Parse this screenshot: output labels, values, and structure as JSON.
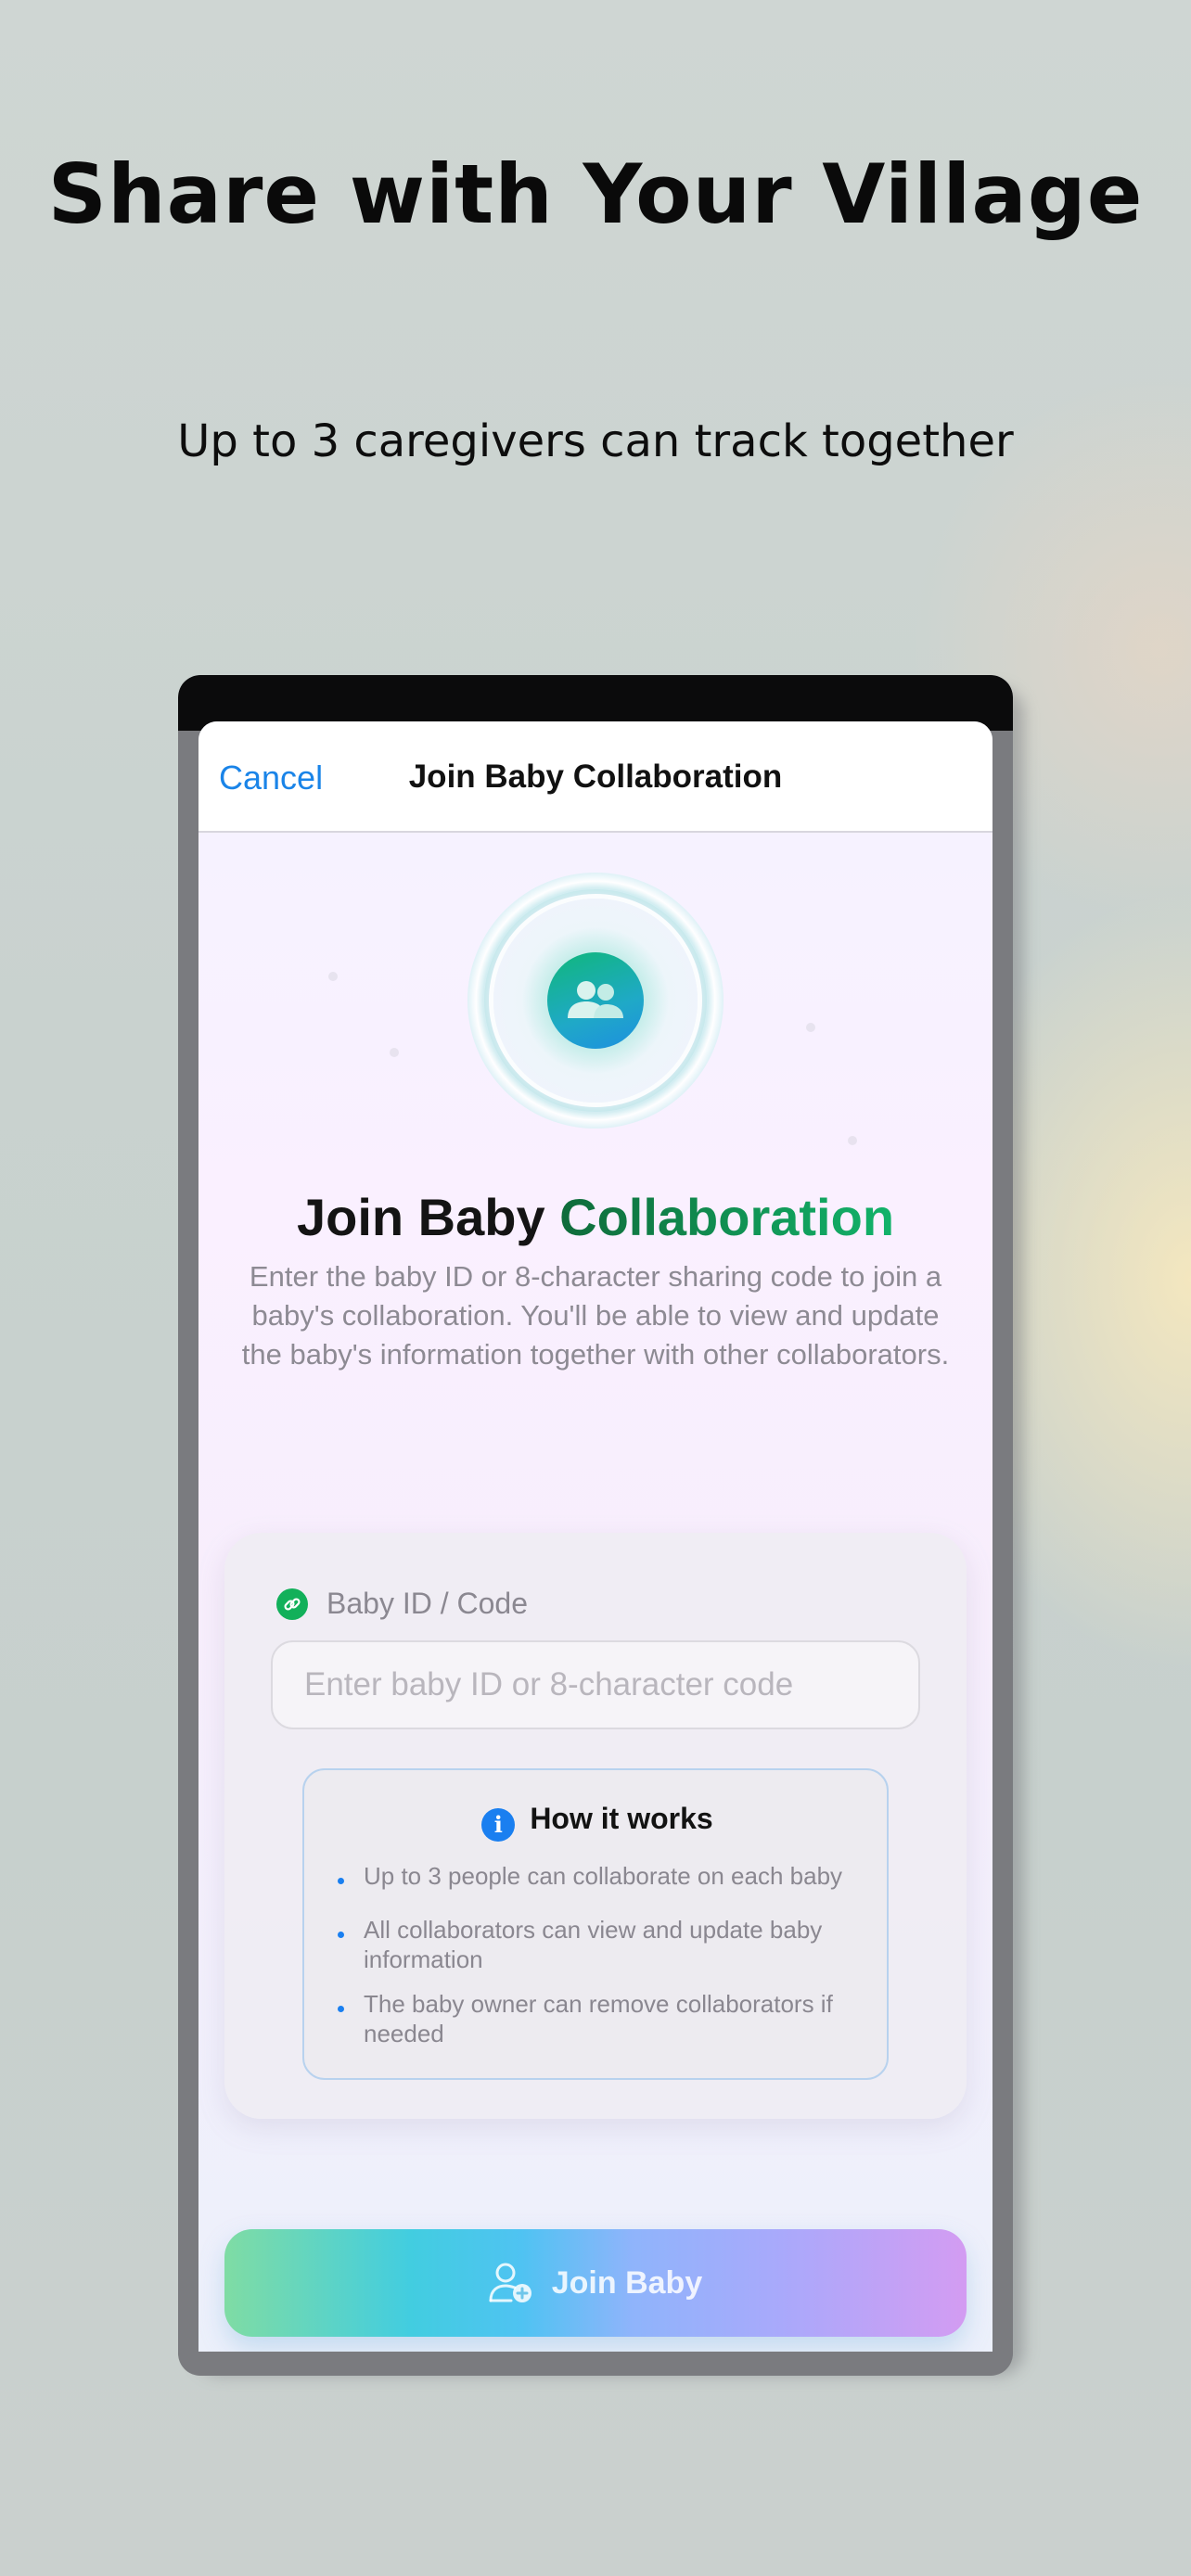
{
  "marketing": {
    "headline": "Share with Your Village",
    "subhead": "Up to 3 caregivers can track together"
  },
  "navbar": {
    "cancel_label": "Cancel",
    "title": "Join Baby Collaboration"
  },
  "hero": {
    "icon": "two-people-icon",
    "title_part1": "Join Baby ",
    "title_part2": "Collaboration",
    "description": "Enter the baby ID or 8-character sharing code to join a baby's collaboration. You'll be able to view and update the baby's information together with other collaborators."
  },
  "form": {
    "label_icon": "link-icon",
    "label": "Baby ID / Code",
    "input_value": "",
    "input_placeholder": "Enter baby ID or 8-character code"
  },
  "how_it_works": {
    "icon": "info-icon",
    "title": "How it works",
    "items": [
      "Up to 3 people can collaborate on each baby",
      "All collaborators can view and update baby information",
      "The baby owner can remove collaborators if needed"
    ]
  },
  "join_button": {
    "icon": "add-person-icon",
    "label": "Join Baby"
  },
  "colors": {
    "accent_blue": "#1a84e8",
    "accent_green": "#12b05a"
  }
}
